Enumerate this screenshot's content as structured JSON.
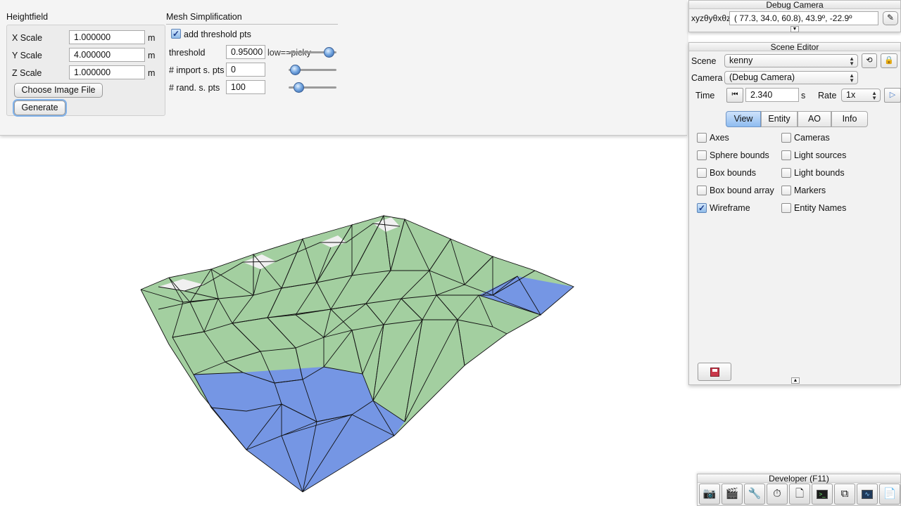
{
  "heightfield": {
    "title": "Heightfield",
    "x_scale_label": "X Scale",
    "x_scale_value": "1.000000",
    "x_unit": "m",
    "y_scale_label": "Y Scale",
    "y_scale_value": "4.000000",
    "y_unit": "m",
    "z_scale_label": "Z Scale",
    "z_scale_value": "1.000000",
    "z_unit": "m",
    "choose_label": "Choose Image File",
    "generate_label": "Generate"
  },
  "mesh": {
    "title": "Mesh Simplification",
    "add_threshold_label": "add threshold pts",
    "add_threshold_checked": true,
    "threshold_label": "threshold",
    "threshold_value": "0.95000",
    "threshold_hint": "low==picky",
    "import_label": "# import s. pts",
    "import_value": "0",
    "rand_label": "# rand. s. pts",
    "rand_value": "100"
  },
  "debug_camera": {
    "title": "Debug Camera",
    "coord_label": "xyzθyθxθz",
    "coord_value": "( 77.3,  34.0,  60.8),  43.9º, -22.9º",
    "expand_icon": "chevron-down"
  },
  "scene_editor": {
    "title": "Scene Editor",
    "scene_label": "Scene",
    "scene_value": "kenny",
    "camera_label": "Camera",
    "camera_value": "(Debug Camera)",
    "time_label": "Time",
    "time_value": "2.340",
    "time_unit": "s",
    "rate_label": "Rate",
    "rate_value": "1x",
    "tabs": [
      {
        "label": "View",
        "active": true
      },
      {
        "label": "Entity",
        "active": false
      },
      {
        "label": "AO",
        "active": false
      },
      {
        "label": "Info",
        "active": false
      }
    ],
    "view_options": [
      {
        "label": "Axes",
        "checked": false
      },
      {
        "label": "Cameras",
        "checked": false
      },
      {
        "label": "Sphere bounds",
        "checked": false
      },
      {
        "label": "Light sources",
        "checked": false
      },
      {
        "label": "Box bounds",
        "checked": false
      },
      {
        "label": "Light bounds",
        "checked": false
      },
      {
        "label": "Box bound array",
        "checked": false
      },
      {
        "label": "Markers",
        "checked": false
      },
      {
        "label": "Wireframe",
        "checked": true
      },
      {
        "label": "Entity Names",
        "checked": false
      }
    ]
  },
  "developer": {
    "title": "Developer (F11)",
    "tools": [
      "camera-icon",
      "clapperboard-icon",
      "wrench-icon",
      "clock-icon",
      "new-window-icon",
      "terminal-icon",
      "layout-icon",
      "profiler-icon",
      "document-icon"
    ]
  },
  "colors": {
    "terrain_green": "#a3cfa0",
    "water_blue": "#7596e4",
    "snow_white": "#f2f2f2",
    "accent_blue": "#8ebcf0"
  }
}
